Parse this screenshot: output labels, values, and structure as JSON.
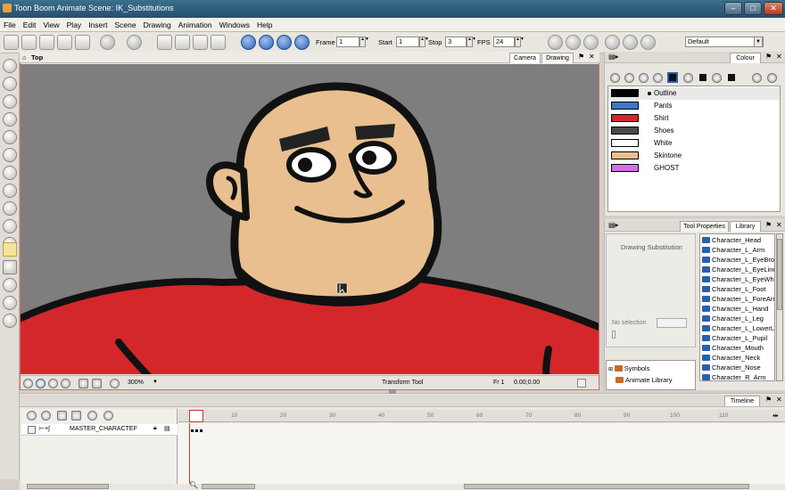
{
  "window": {
    "title": "Toon Boom Animate Scene: IK_Substitutions"
  },
  "menu": [
    "File",
    "Edit",
    "View",
    "Play",
    "Insert",
    "Scene",
    "Drawing",
    "Animation",
    "Windows",
    "Help"
  ],
  "toolbar": {
    "frame_label": "Frame",
    "frame_value": "1",
    "start_label": "Start",
    "start_value": "1",
    "stop_label": "Stop",
    "stop_value": "3",
    "fps_label": "FPS",
    "fps_value": "24",
    "workspace": "Default"
  },
  "view": {
    "title": "Top",
    "tabs": [
      "Camera",
      "Drawing"
    ],
    "zoom": "300%",
    "tool_name": "Transform Tool",
    "frame_status": "Fr 1",
    "coords": "0.00;0.00"
  },
  "colour_panel": {
    "tab": "Colour",
    "colors": [
      {
        "name": "Outline",
        "hex": "#000000"
      },
      {
        "name": "Pants",
        "hex": "#3b78c9"
      },
      {
        "name": "Shirt",
        "hex": "#d3272b"
      },
      {
        "name": "Shoes",
        "hex": "#4a4a4a"
      },
      {
        "name": "White",
        "hex": "#ffffff"
      },
      {
        "name": "Skintone",
        "hex": "#e9bf8f"
      },
      {
        "name": "GHOST",
        "hex": "#d46fe3"
      }
    ]
  },
  "library_panel": {
    "tabs": [
      "Tool Properties",
      "Library"
    ],
    "drawing_substitution_label": "Drawing Substitution",
    "no_selection": "No selection",
    "items": [
      "Character_Head",
      "Character_L_Arm",
      "Character_L_EyeBrow",
      "Character_L_EyeLine",
      "Character_L_EyeWhite",
      "Character_L_Foot",
      "Character_L_ForeArm",
      "Character_L_Hand",
      "Character_L_Leg",
      "Character_L_LowerLeg",
      "Character_L_Pupil",
      "Character_Mouth",
      "Character_Neck",
      "Character_Nose",
      "Character_R_Arm"
    ],
    "tree": [
      "Symbols",
      "Animate Library"
    ]
  },
  "timeline": {
    "tab": "Timeline",
    "layer": "MASTER_CHARACTEF",
    "ticks": [
      "10",
      "20",
      "30",
      "40",
      "50",
      "60",
      "70",
      "80",
      "90",
      "100",
      "110"
    ]
  },
  "character_colors": {
    "skin": "#e9bf8f",
    "shirt": "#d3272b",
    "outline": "#111111",
    "bg": "#7e7e7e"
  }
}
